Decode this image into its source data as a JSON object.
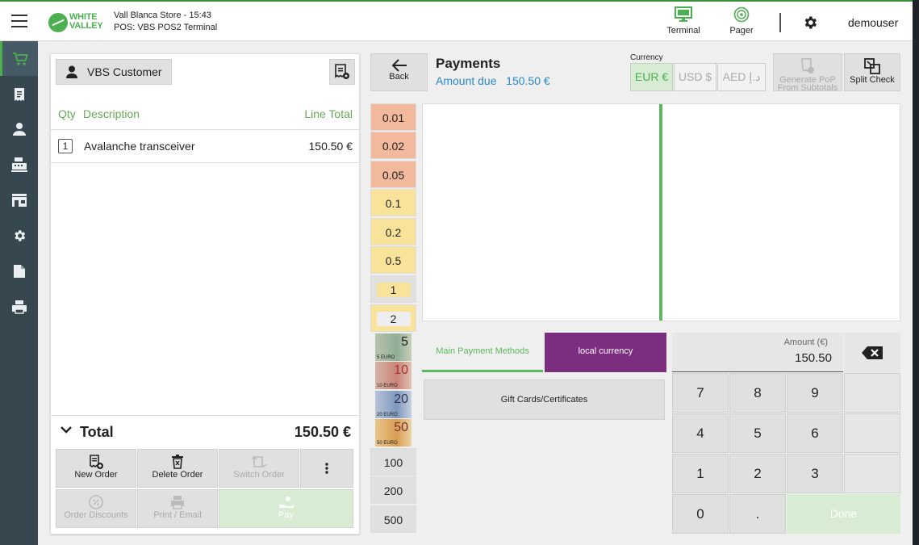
{
  "topbar": {
    "logo_line1": "WHITE",
    "logo_line2": "VALLEY",
    "store_line": "Vall Blanca Store - 15:43",
    "pos_line": "POS: VBS POS2 Terminal",
    "terminal_label": "Terminal",
    "pager_label": "Pager",
    "username": "demouser"
  },
  "sidebar": {
    "items": [
      "cart-icon",
      "receipt-icon",
      "person-icon",
      "cash-register-icon",
      "store-icon",
      "gear-icon",
      "document-icon",
      "printer-icon"
    ]
  },
  "order": {
    "customer": "VBS Customer",
    "col_qty": "Qty",
    "col_desc": "Description",
    "col_total": "Line Total",
    "lines": [
      {
        "qty": "1",
        "desc": "Avalanche transceiver",
        "total": "150.50 €"
      }
    ],
    "total_label": "Total",
    "total_value": "150.50 €",
    "actions": {
      "new_order": "New Order",
      "delete_order": "Delete Order",
      "switch_order": "Switch Order",
      "order_discounts": "Order Discounts",
      "print_email": "Print / Email",
      "pay": "Pay"
    }
  },
  "payments": {
    "back": "Back",
    "title": "Payments",
    "amount_due_label": "Amount due",
    "amount_due_value": "150.50 €",
    "currency_label": "Currency",
    "currencies": [
      "EUR €",
      "USD $",
      "AED د.إ"
    ],
    "generate_pop": "Generate PoP From Subtotals",
    "split_check": "Split Check",
    "denominations": [
      "0.01",
      "0.02",
      "0.05",
      "0.1",
      "0.2",
      "0.5",
      "1",
      "2"
    ],
    "notes": [
      {
        "value": "5",
        "caption": "5 EURO"
      },
      {
        "value": "10",
        "caption": "10 EURO"
      },
      {
        "value": "20",
        "caption": "20 EURO"
      },
      {
        "value": "50",
        "caption": "50 EURO"
      }
    ],
    "big_denoms": [
      "100",
      "200",
      "500"
    ],
    "tab_main": "Main Payment Methods",
    "tab_local": "local currency",
    "gift_cards": "Gift Cards/Certificates",
    "amount_label": "Amount (€)",
    "amount_value": "150.50",
    "keys": [
      "7",
      "8",
      "9",
      "4",
      "5",
      "6",
      "1",
      "2",
      "3",
      "0",
      "."
    ],
    "done": "Done"
  },
  "colors": {
    "accent_green": "#4caf50",
    "local_currency_purple": "#7b2d7e",
    "amount_due_blue": "#2a88c8"
  }
}
